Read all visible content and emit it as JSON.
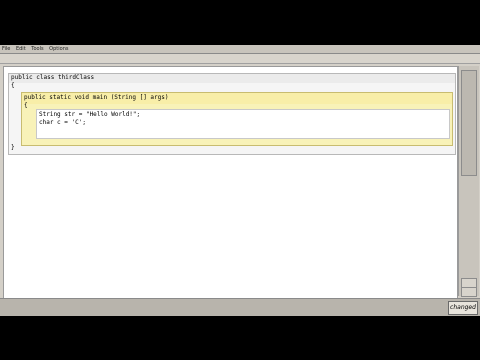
{
  "menu": [
    "File",
    "Edit",
    "Tools",
    "Options"
  ],
  "editor": {
    "class_header": "public class thirdClass",
    "class_open_brace": "{",
    "class_close_brace": "}",
    "method_header": "public static void main (String [] args)",
    "method_open_brace": "{",
    "body_lines": [
      "String str = \"Hello World!\";",
      "char c = 'C';"
    ]
  },
  "status": {
    "changed_label": "changed"
  }
}
